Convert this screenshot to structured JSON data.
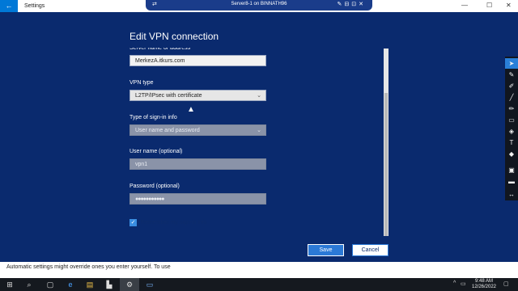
{
  "window": {
    "title": "Settings",
    "back_icon": "back-arrow-icon",
    "controls": [
      "—",
      "☐",
      "✕"
    ]
  },
  "remote_bar": {
    "title": "Server8-1 on BINNATH96",
    "left_glyph": "⇄",
    "right_glyphs": "✎⊟⊡✕"
  },
  "dialog": {
    "heading": "Edit VPN connection",
    "server_label": "Server name or address",
    "server_value": "MerkezA.itkurs.com",
    "vpn_type_label": "VPN type",
    "vpn_type_value": "L2TP/IPsec with certificate",
    "signin_label": "Type of sign-in info",
    "signin_value": "User name and password",
    "username_label": "User name (optional)",
    "username_value": "vpn1",
    "password_label": "Password (optional)",
    "password_value": "●●●●●●●●●●●",
    "remember_label": "Remember my sign-in info",
    "remember_checked": true,
    "save_label": "Save",
    "cancel_label": "Cancel"
  },
  "background": {
    "settings_text": "Automatic settings might override ones you enter yourself. To use"
  },
  "pen_toolbar": {
    "tools": [
      "arrow-cursor-icon",
      "pencil-icon",
      "marker-icon",
      "line-icon",
      "brush-icon",
      "rectangle-icon",
      "paint-bucket-icon",
      "text-icon",
      "eraser-icon",
      "clear-icon",
      "line-weight-icon",
      "expand-icon"
    ]
  },
  "taskbar": {
    "icons": [
      "windows-start-icon",
      "search-icon",
      "task-view-icon",
      "ie-icon",
      "explorer-icon",
      "server-manager-icon",
      "settings-icon",
      "vpn-app-icon"
    ],
    "time": "9:48 AM",
    "date": "12/26/2022"
  }
}
